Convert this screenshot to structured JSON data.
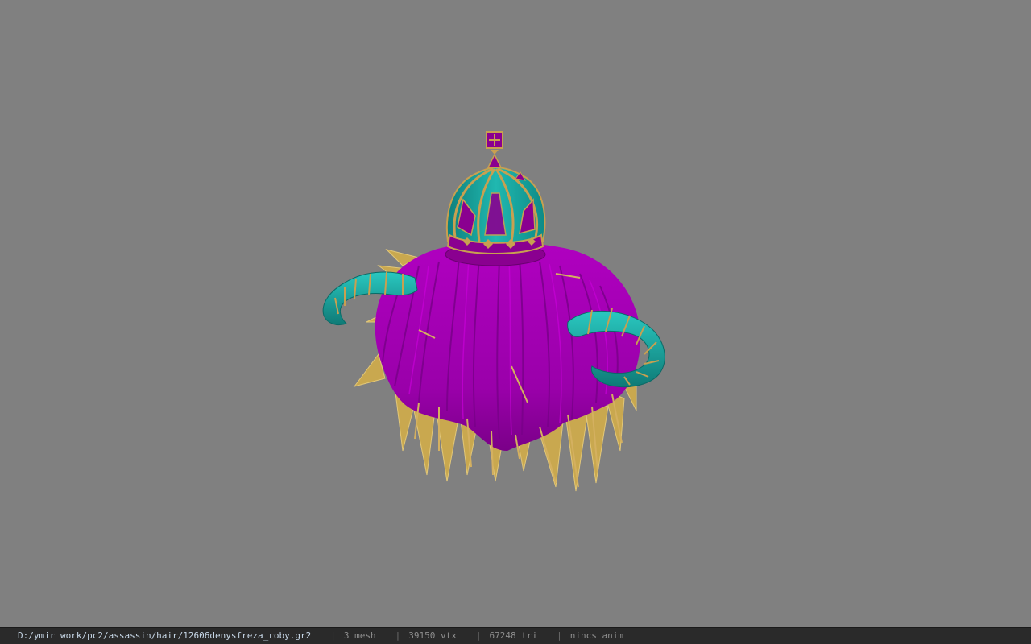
{
  "viewport": {
    "background_color": "#808080",
    "model": {
      "colors": {
        "hair": "#a000b0",
        "hair_dark": "#6e0080",
        "hair_tips": "#d4b060",
        "crown_body": "#16a6a0",
        "crown_trim": "#c8a050",
        "crown_purple": "#8a0090",
        "horns": "#18a8a4",
        "horn_bands": "#c8a050"
      }
    }
  },
  "status_bar": {
    "file_path": "D:/ymir work/pc2/assassin/hair/12606denysfreza_roby.gr2",
    "separator": "|",
    "mesh_count": "3 mesh",
    "vertex_count": "39150 vtx",
    "triangle_count": "67248 tri",
    "anim_status": "nincs anim"
  }
}
